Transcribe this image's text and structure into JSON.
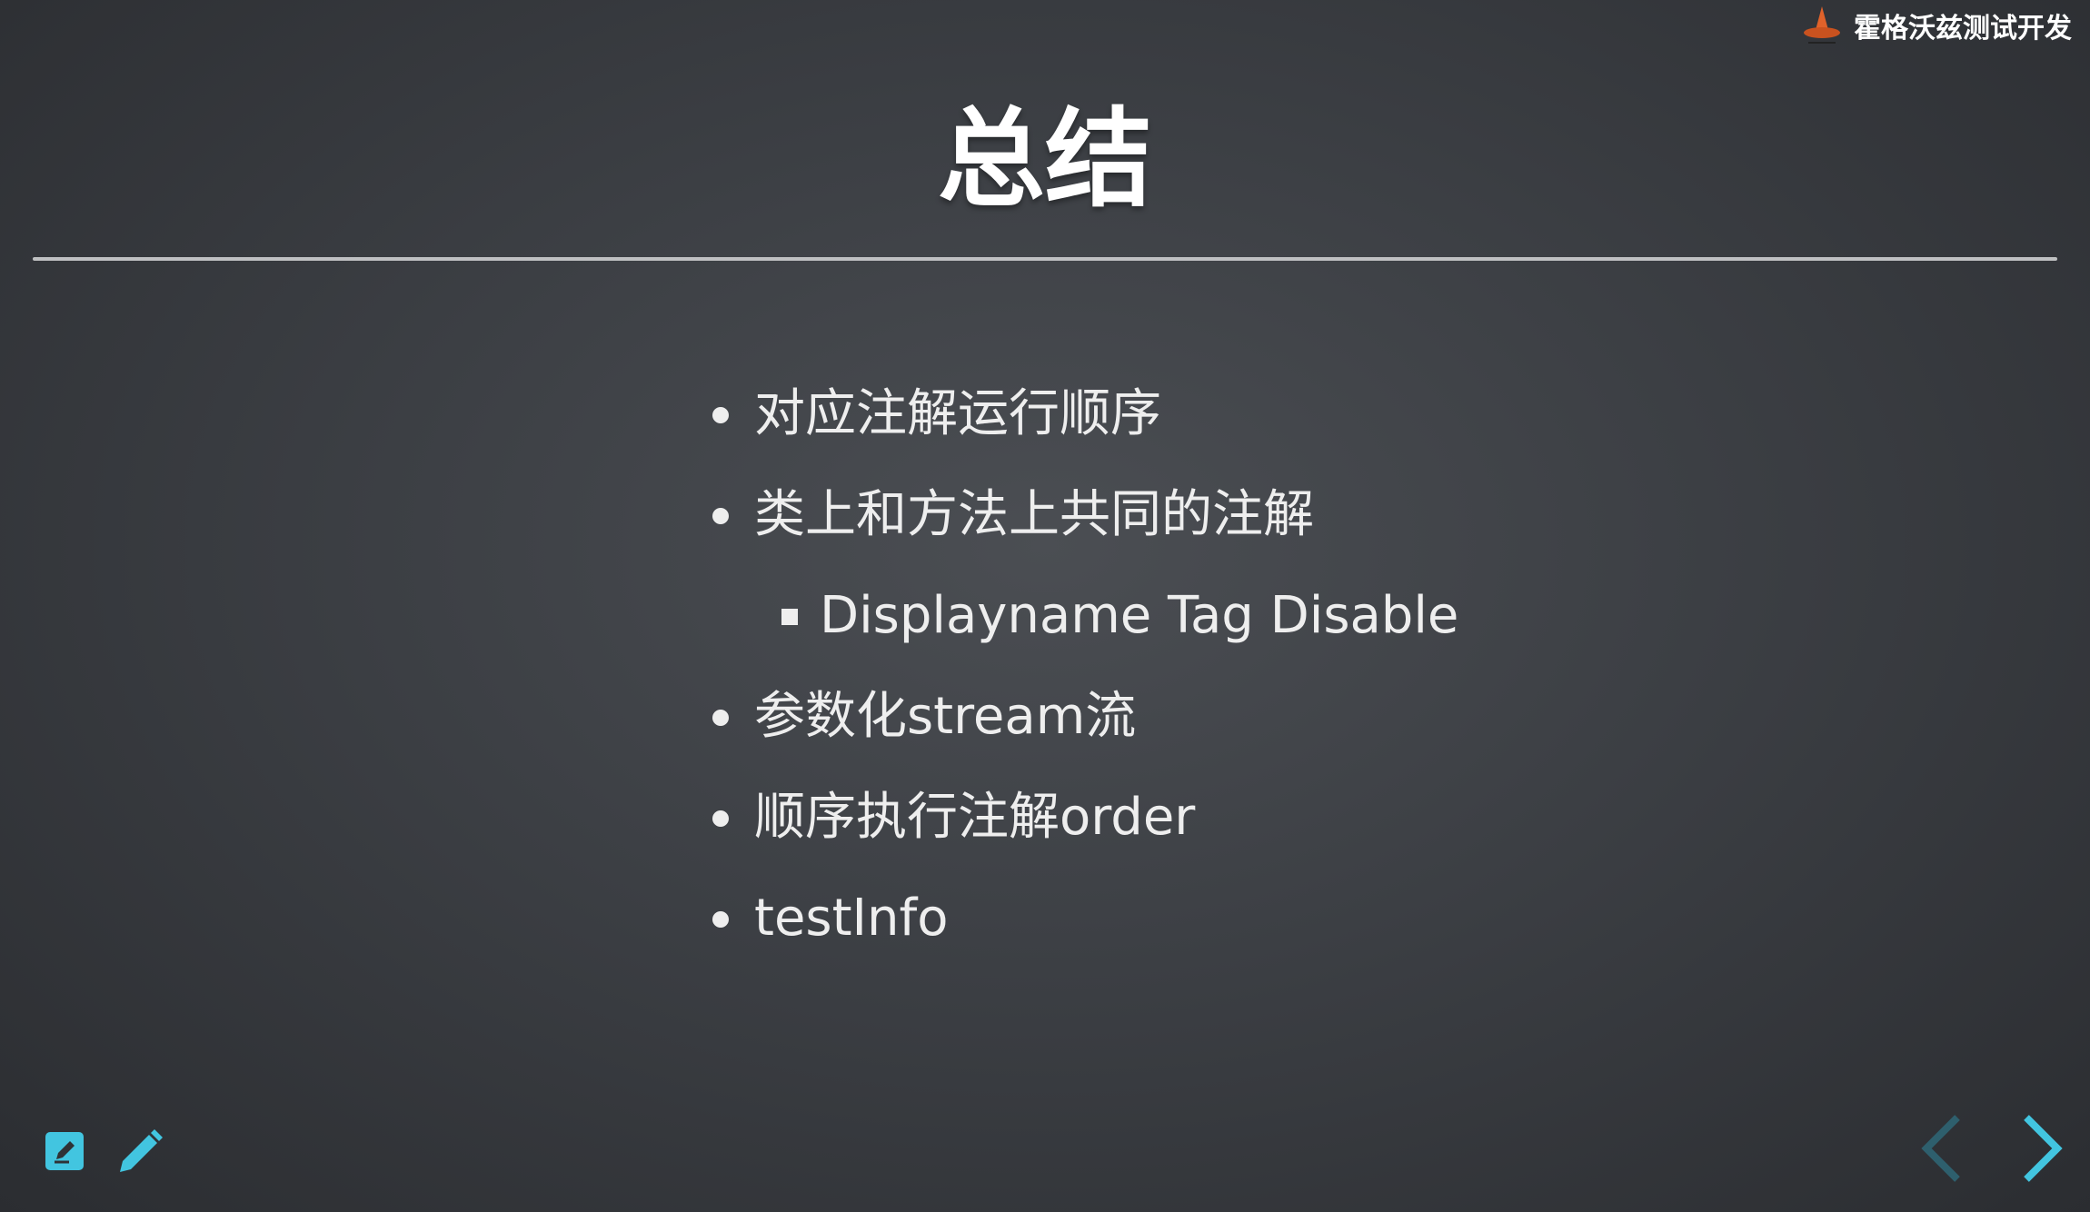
{
  "brand": {
    "name": "霍格沃兹测试开发",
    "logo_icon": "wizard-hat-icon",
    "logo_color": "#e0622a"
  },
  "slide": {
    "title": "总结",
    "bullets": [
      {
        "text": "对应注解运行顺序",
        "level": 1
      },
      {
        "text": "类上和方法上共同的注解",
        "level": 1
      },
      {
        "text": "Displayname Tag Disable",
        "level": 2
      },
      {
        "text": "参数化stream流",
        "level": 1
      },
      {
        "text": "顺序执行注解order",
        "level": 1
      },
      {
        "text": "testInfo",
        "level": 1
      }
    ]
  },
  "controls": {
    "edit_icon": "edit-note-icon",
    "pen_icon": "pencil-icon",
    "prev_icon": "chevron-left-icon",
    "next_icon": "chevron-right-icon",
    "accent_color": "#42c5e0"
  }
}
